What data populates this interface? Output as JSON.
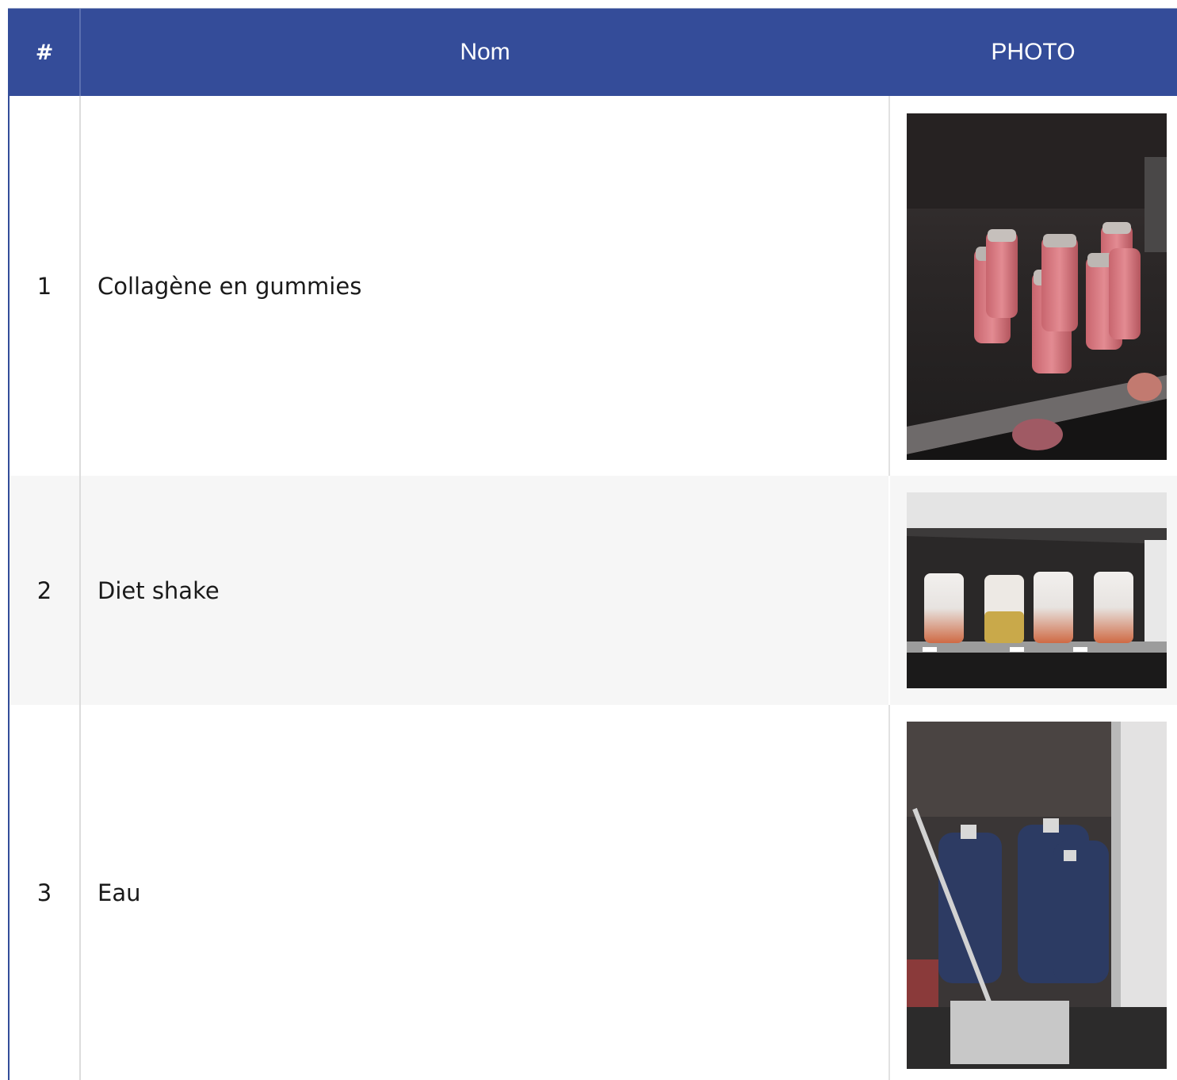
{
  "table": {
    "headers": {
      "number": "#",
      "name": "Nom",
      "photo": "PHOTO"
    },
    "rows": [
      {
        "number": "1",
        "name": "Collagène en gummies",
        "photo_icon": "product-photo-collagen-gummies"
      },
      {
        "number": "2",
        "name": "Diet shake",
        "photo_icon": "product-photo-diet-shake"
      },
      {
        "number": "3",
        "name": "Eau",
        "photo_icon": "product-photo-water-bottles"
      }
    ]
  },
  "colors": {
    "header_bg": "#344c99",
    "header_text": "#ffffff",
    "row_alt_bg": "#f6f6f6"
  }
}
